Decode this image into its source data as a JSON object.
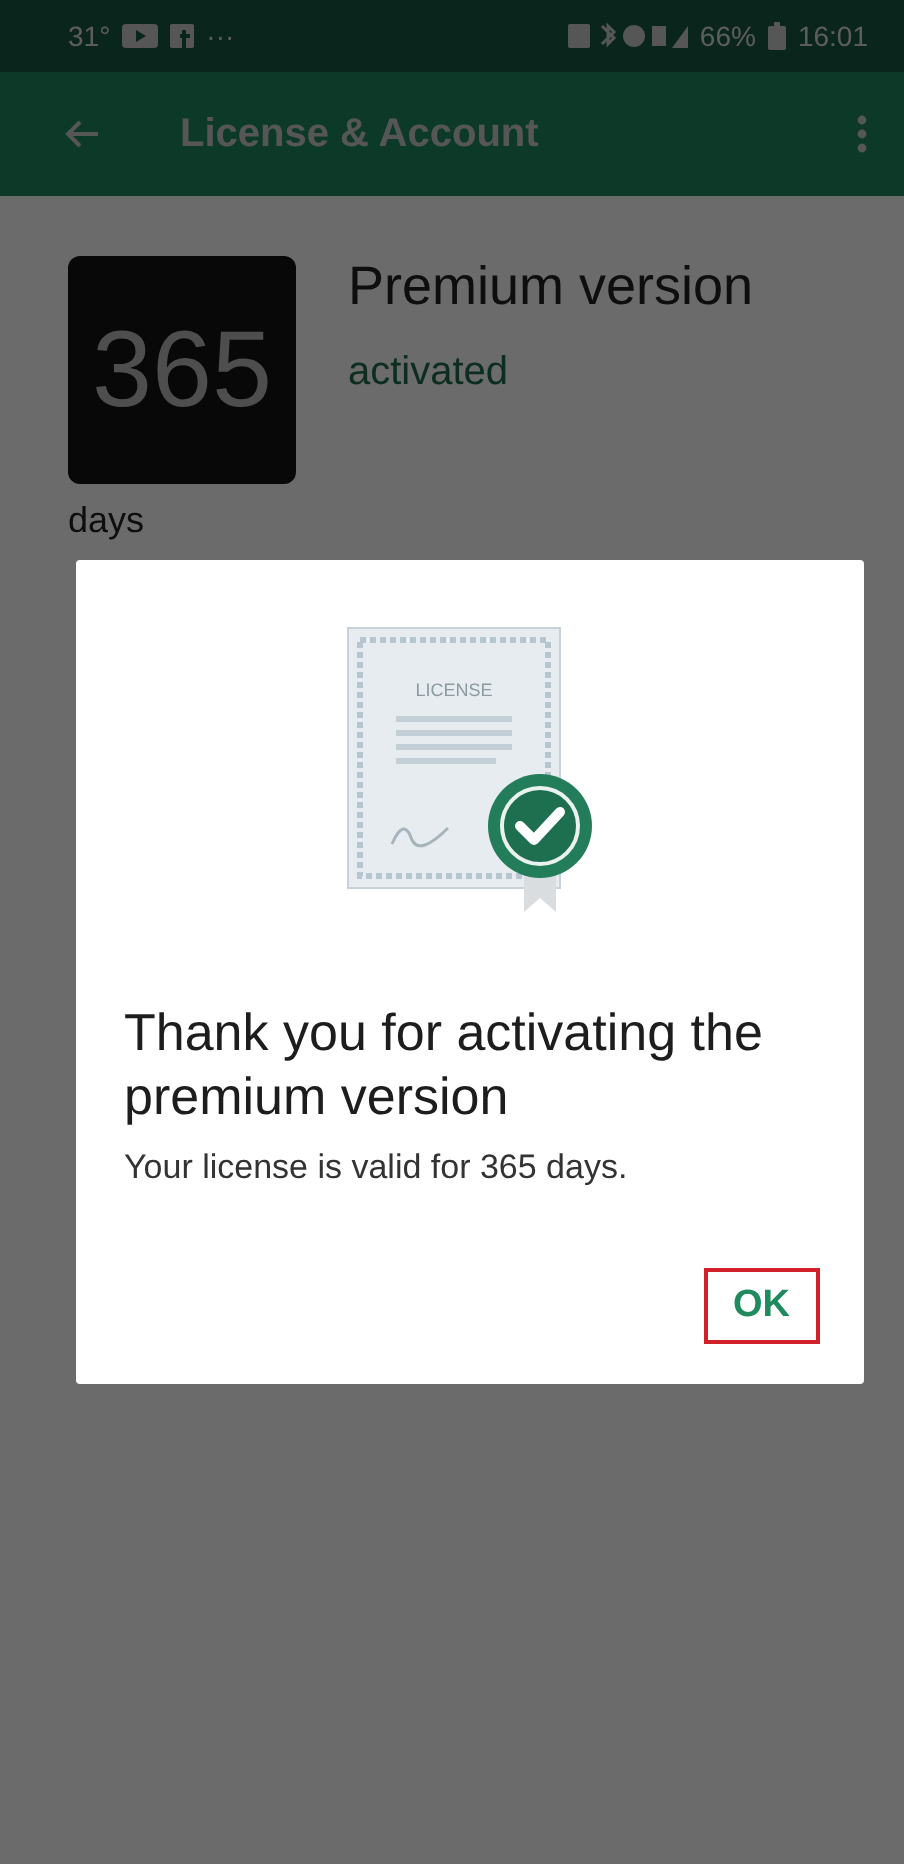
{
  "status_bar": {
    "temperature": "31°",
    "more": "···",
    "battery": "66%",
    "time": "16:01"
  },
  "app_bar": {
    "title": "License & Account"
  },
  "license": {
    "counter": "365",
    "counter_caption": "days",
    "title": "Premium version",
    "state": "activated"
  },
  "dialog": {
    "illustration_label": "LICENSE",
    "title": "Thank you for activating the premium version",
    "message": "Your license is valid for 365 days.",
    "button": {
      "label": "OK",
      "highlighted": true
    }
  }
}
